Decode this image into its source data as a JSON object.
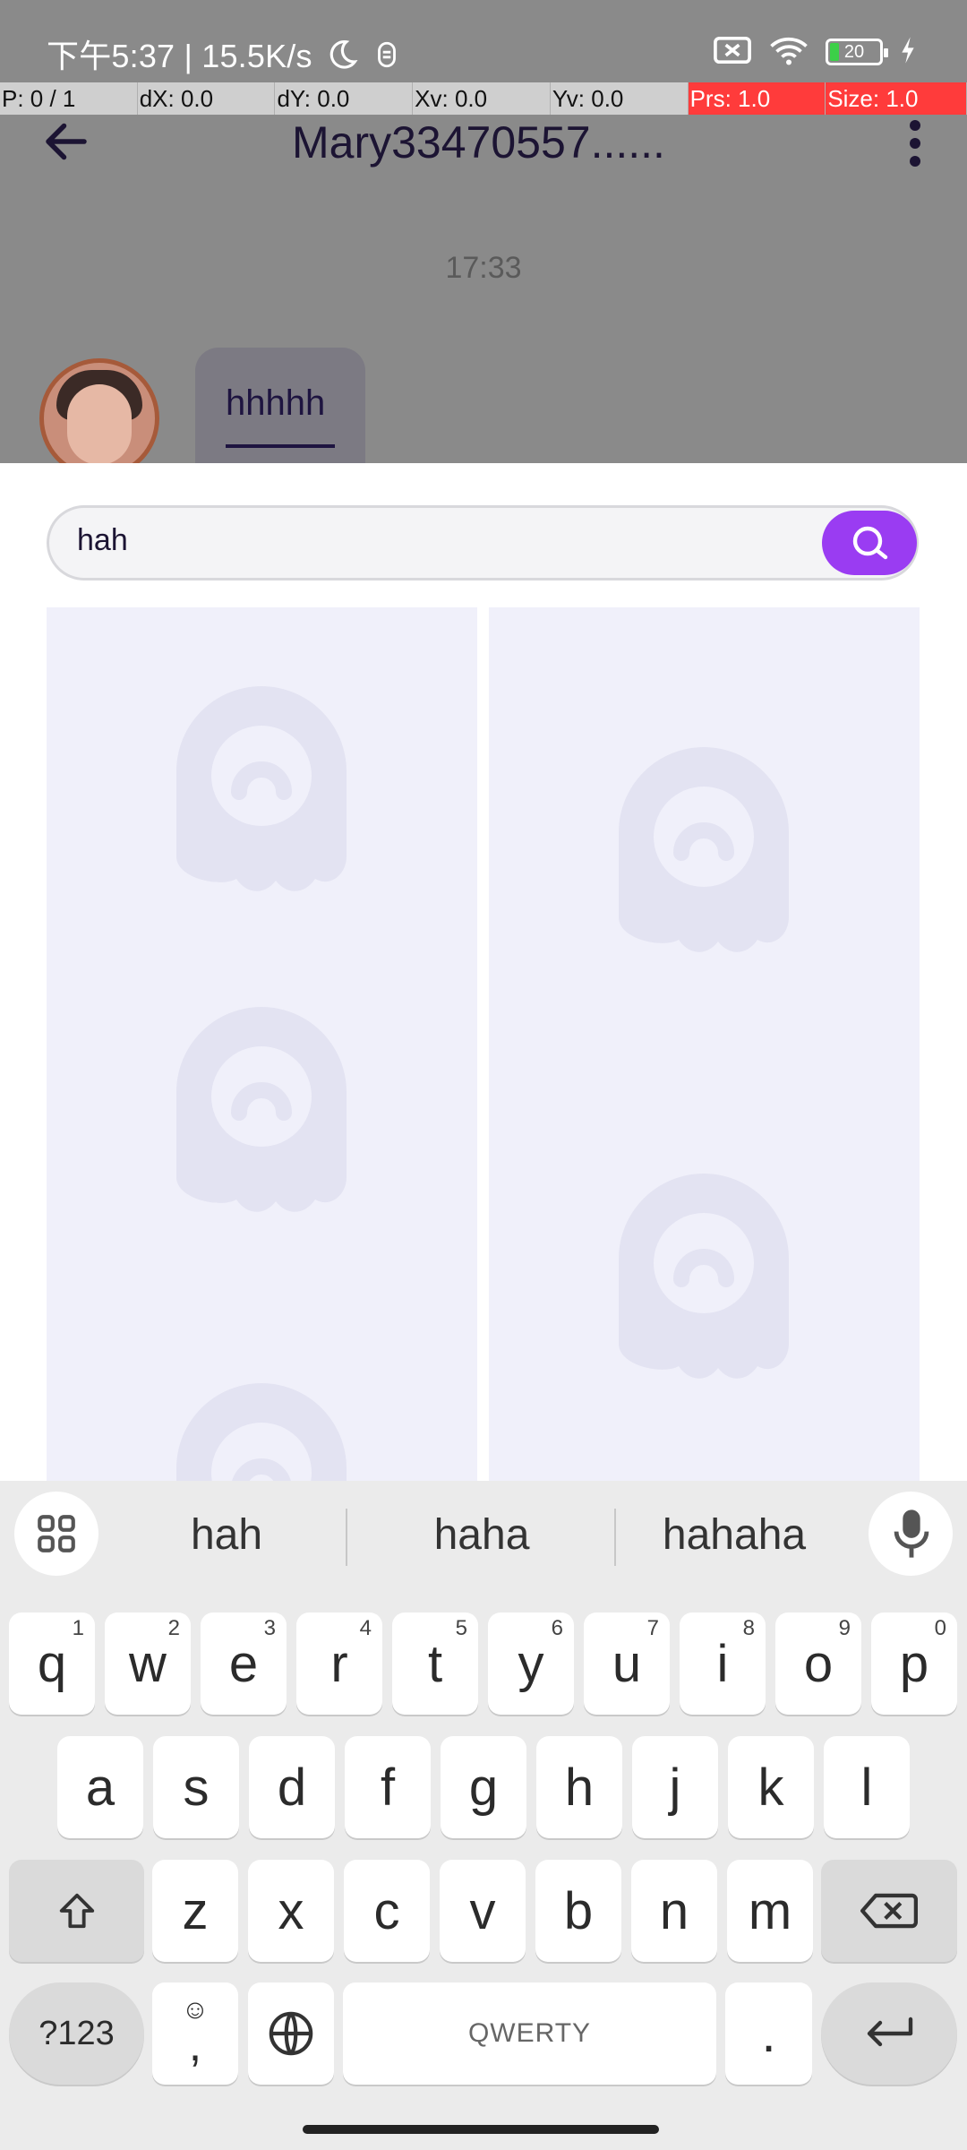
{
  "status_bar": {
    "time_speed": "下午5:37 | 15.5K/s",
    "battery_level": "20"
  },
  "debug_bar": [
    {
      "label": "P: 0 / 1"
    },
    {
      "label": "dX: 0.0"
    },
    {
      "label": "dY: 0.0"
    },
    {
      "label": "Xv: 0.0"
    },
    {
      "label": "Yv: 0.0"
    },
    {
      "label": "Prs: 1.0"
    },
    {
      "label": "Size: 1.0"
    }
  ],
  "chat": {
    "title": "Mary33470557......",
    "timestamp": "17:33",
    "message": "hhhhh"
  },
  "sticker_search": {
    "query": "hah",
    "accent_color": "#9a3cf2"
  },
  "keyboard": {
    "suggestions": [
      "hah",
      "haha",
      "hahaha"
    ],
    "row1": [
      {
        "k": "q",
        "n": "1"
      },
      {
        "k": "w",
        "n": "2"
      },
      {
        "k": "e",
        "n": "3"
      },
      {
        "k": "r",
        "n": "4"
      },
      {
        "k": "t",
        "n": "5"
      },
      {
        "k": "y",
        "n": "6"
      },
      {
        "k": "u",
        "n": "7"
      },
      {
        "k": "i",
        "n": "8"
      },
      {
        "k": "o",
        "n": "9"
      },
      {
        "k": "p",
        "n": "0"
      }
    ],
    "row2": [
      "a",
      "s",
      "d",
      "f",
      "g",
      "h",
      "j",
      "k",
      "l"
    ],
    "row3": [
      "z",
      "x",
      "c",
      "v",
      "b",
      "n",
      "m"
    ],
    "symbols_label": "?123",
    "comma_label": ",",
    "space_label": "QWERTY",
    "period_label": "."
  }
}
